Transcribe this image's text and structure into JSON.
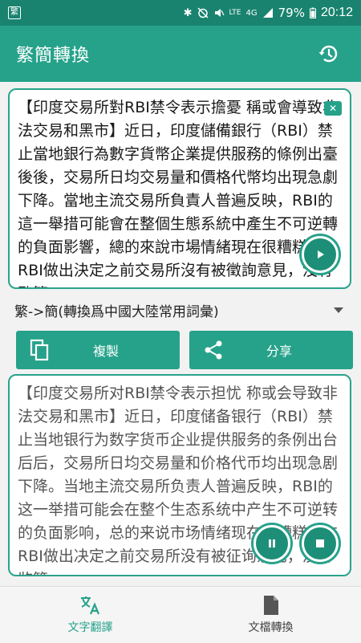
{
  "status_bar": {
    "notification_glyph": "繁",
    "bluetooth": "✱",
    "lte_label": "LTE",
    "network_label": "4G",
    "battery": "79%",
    "time": "20:12"
  },
  "app_bar": {
    "title": "繁簡轉換",
    "theme_icon": "moon-icon",
    "history_icon": "history-icon"
  },
  "input_card": {
    "text": "【印度交易所對RBI禁令表示擔憂 稱或會導致非法交易和黑市】近日，印度儲備銀行（RBI）禁止當地銀行為數字貨幣企業提供服務的條例出臺後後，交易所日均交易量和價格代幣均出現急劇下降。當地主流交易所負責人普遍反映，RBI的這一舉措可能會在整個生態系統中產生不可逆轉的負面影響，總的來說市場情緒現在很糟糕。在RBI做出決定之前交易所沒有被徵詢意見，沒有監管",
    "close_glyph": "✕"
  },
  "mode_selector": {
    "selected": "繁->簡(轉換爲中國大陸常用詞彙)"
  },
  "actions": {
    "copy_label": "複製",
    "share_label": "分享"
  },
  "output_card": {
    "text": "【印度交易所对RBI禁令表示担忧 称或会导致非法交易和黑市】近日，印度储备银行（RBI）禁止当地银行为数字货币企业提供服务的条例出台后后，交易所日均交易量和价格代币均出现急剧下降。当地主流交易所负责人普遍反映，RBI的这一举措可能会在整个生态系统中产生不可逆转的负面影响，总的来说市场情绪现在很糟糕。在RBI做出决定之前交易所没有被征询意见，没有监管"
  },
  "bottom_nav": {
    "items": [
      {
        "label": "文字翻譯",
        "icon": "translate-icon"
      },
      {
        "label": "文檔轉換",
        "icon": "document-icon"
      }
    ]
  },
  "colors": {
    "status_bar": "#19836f",
    "primary": "#26a28a",
    "fab": "#1d8f78"
  }
}
